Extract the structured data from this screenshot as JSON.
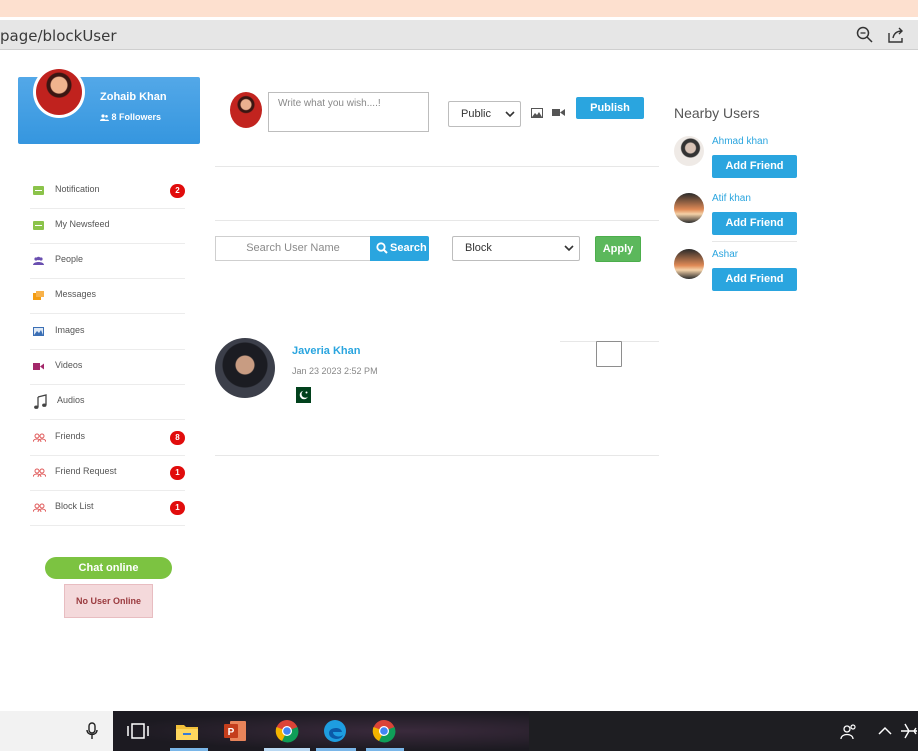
{
  "browser": {
    "url_text": "page/blockUser"
  },
  "profile": {
    "name": "Zohaib Khan",
    "followers": "8 Followers"
  },
  "menu": [
    {
      "label": "Notification",
      "badge": "2",
      "icon": "notification-icon",
      "color": "#8bc34a"
    },
    {
      "label": "My Newsfeed",
      "badge": "",
      "icon": "newsfeed-icon",
      "color": "#8bc34a"
    },
    {
      "label": "People",
      "badge": "",
      "icon": "people-icon",
      "color": "#6a4fb0"
    },
    {
      "label": "Messages",
      "badge": "",
      "icon": "messages-icon",
      "color": "#f39c12"
    },
    {
      "label": "Images",
      "badge": "",
      "icon": "images-icon",
      "color": "#3b6fb5"
    },
    {
      "label": "Videos",
      "badge": "",
      "icon": "videos-icon",
      "color": "#a3286a"
    },
    {
      "label": "Audios",
      "badge": "",
      "icon": "music-note-icon",
      "color": "#444444"
    },
    {
      "label": "Friends",
      "badge": "8",
      "icon": "friends-icon",
      "color": "#e05a5a"
    },
    {
      "label": "Friend Request",
      "badge": "1",
      "icon": "friend-request-icon",
      "color": "#e05a5a"
    },
    {
      "label": "Block List",
      "badge": "1",
      "icon": "block-list-icon",
      "color": "#e05a5a"
    }
  ],
  "chat": {
    "online_label": "Chat online",
    "no_user_label": "No User Online"
  },
  "composer": {
    "placeholder": "Write what you wish....!",
    "visibility": "Public",
    "publish_label": "Publish"
  },
  "search": {
    "placeholder": "Search User Name",
    "button_label": "Search",
    "filter_value": "Block",
    "apply_label": "Apply"
  },
  "results": [
    {
      "name": "Javeria Khan",
      "date": "Jan 23 2023 2:52 PM",
      "flag": "pakistan-flag-icon"
    }
  ],
  "nearby": {
    "title": "Nearby Users",
    "button_label": "Add Friend",
    "users": [
      {
        "name": "Ahmad khan"
      },
      {
        "name": "Atif khan"
      },
      {
        "name": "Ashar"
      }
    ]
  },
  "colors": {
    "accent": "#2aa5df",
    "apply": "#5cb85c",
    "chat": "#7cc341",
    "badge": "#e10c0c"
  }
}
